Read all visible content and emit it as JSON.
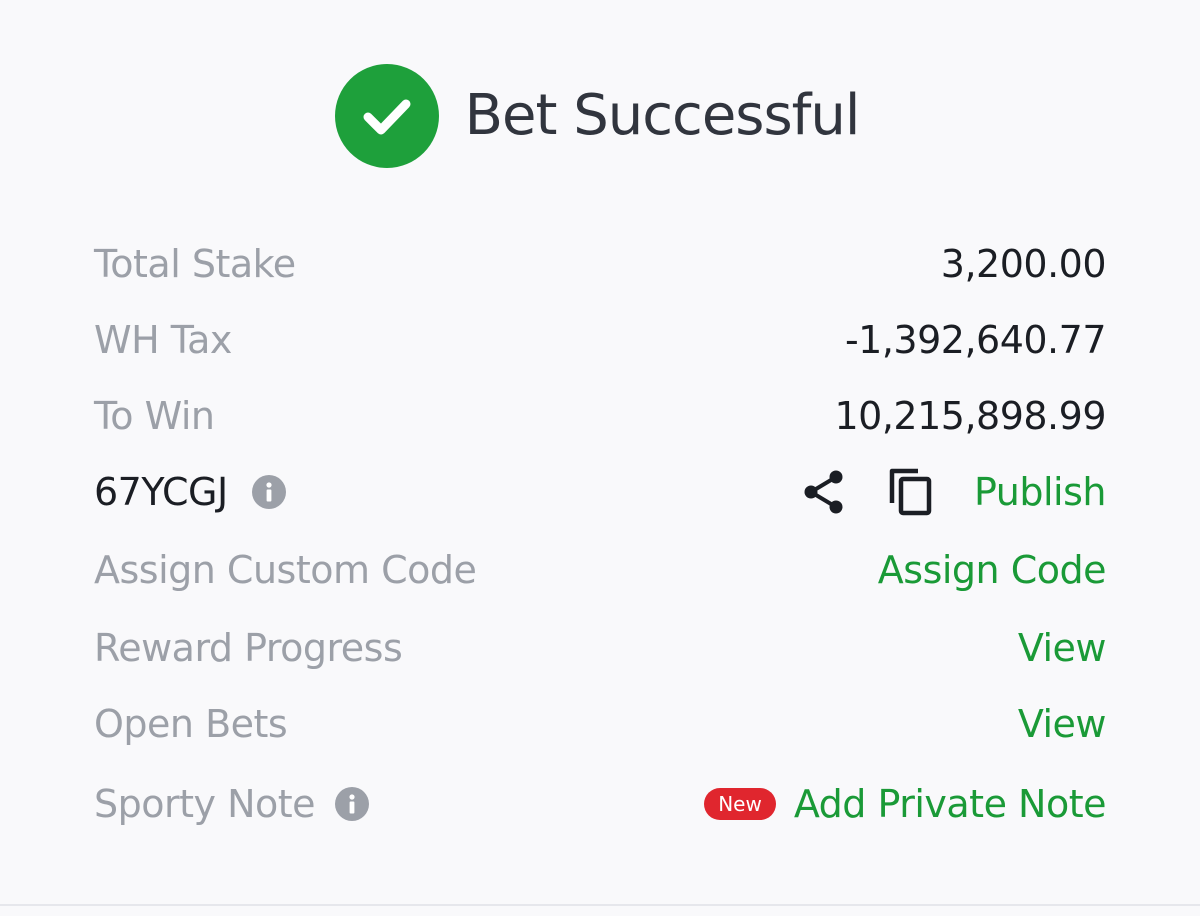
{
  "header": {
    "title": "Bet Successful",
    "icon": "check-circle-icon",
    "accent_color": "#1ea03b"
  },
  "summary": {
    "total_stake": {
      "label": "Total Stake",
      "value": "3,200.00"
    },
    "wh_tax": {
      "label": "WH Tax",
      "value": "-1,392,640.77"
    },
    "to_win": {
      "label": "To Win",
      "value": "10,215,898.99"
    }
  },
  "booking": {
    "code": "67YCGJ",
    "info_icon": "info-icon",
    "share_icon": "share-icon",
    "copy_icon": "copy-icon",
    "publish_label": "Publish"
  },
  "custom_code": {
    "label": "Assign Custom Code",
    "action": "Assign Code"
  },
  "reward_progress": {
    "label": "Reward Progress",
    "action": "View"
  },
  "open_bets": {
    "label": "Open Bets",
    "action": "View"
  },
  "sporty_note": {
    "label": "Sporty Note",
    "badge": "New",
    "action": "Add Private Note",
    "badge_color": "#e0262e"
  },
  "colors": {
    "link": "#1a9a37",
    "muted": "#9ca0a8",
    "text": "#1b1e24"
  }
}
